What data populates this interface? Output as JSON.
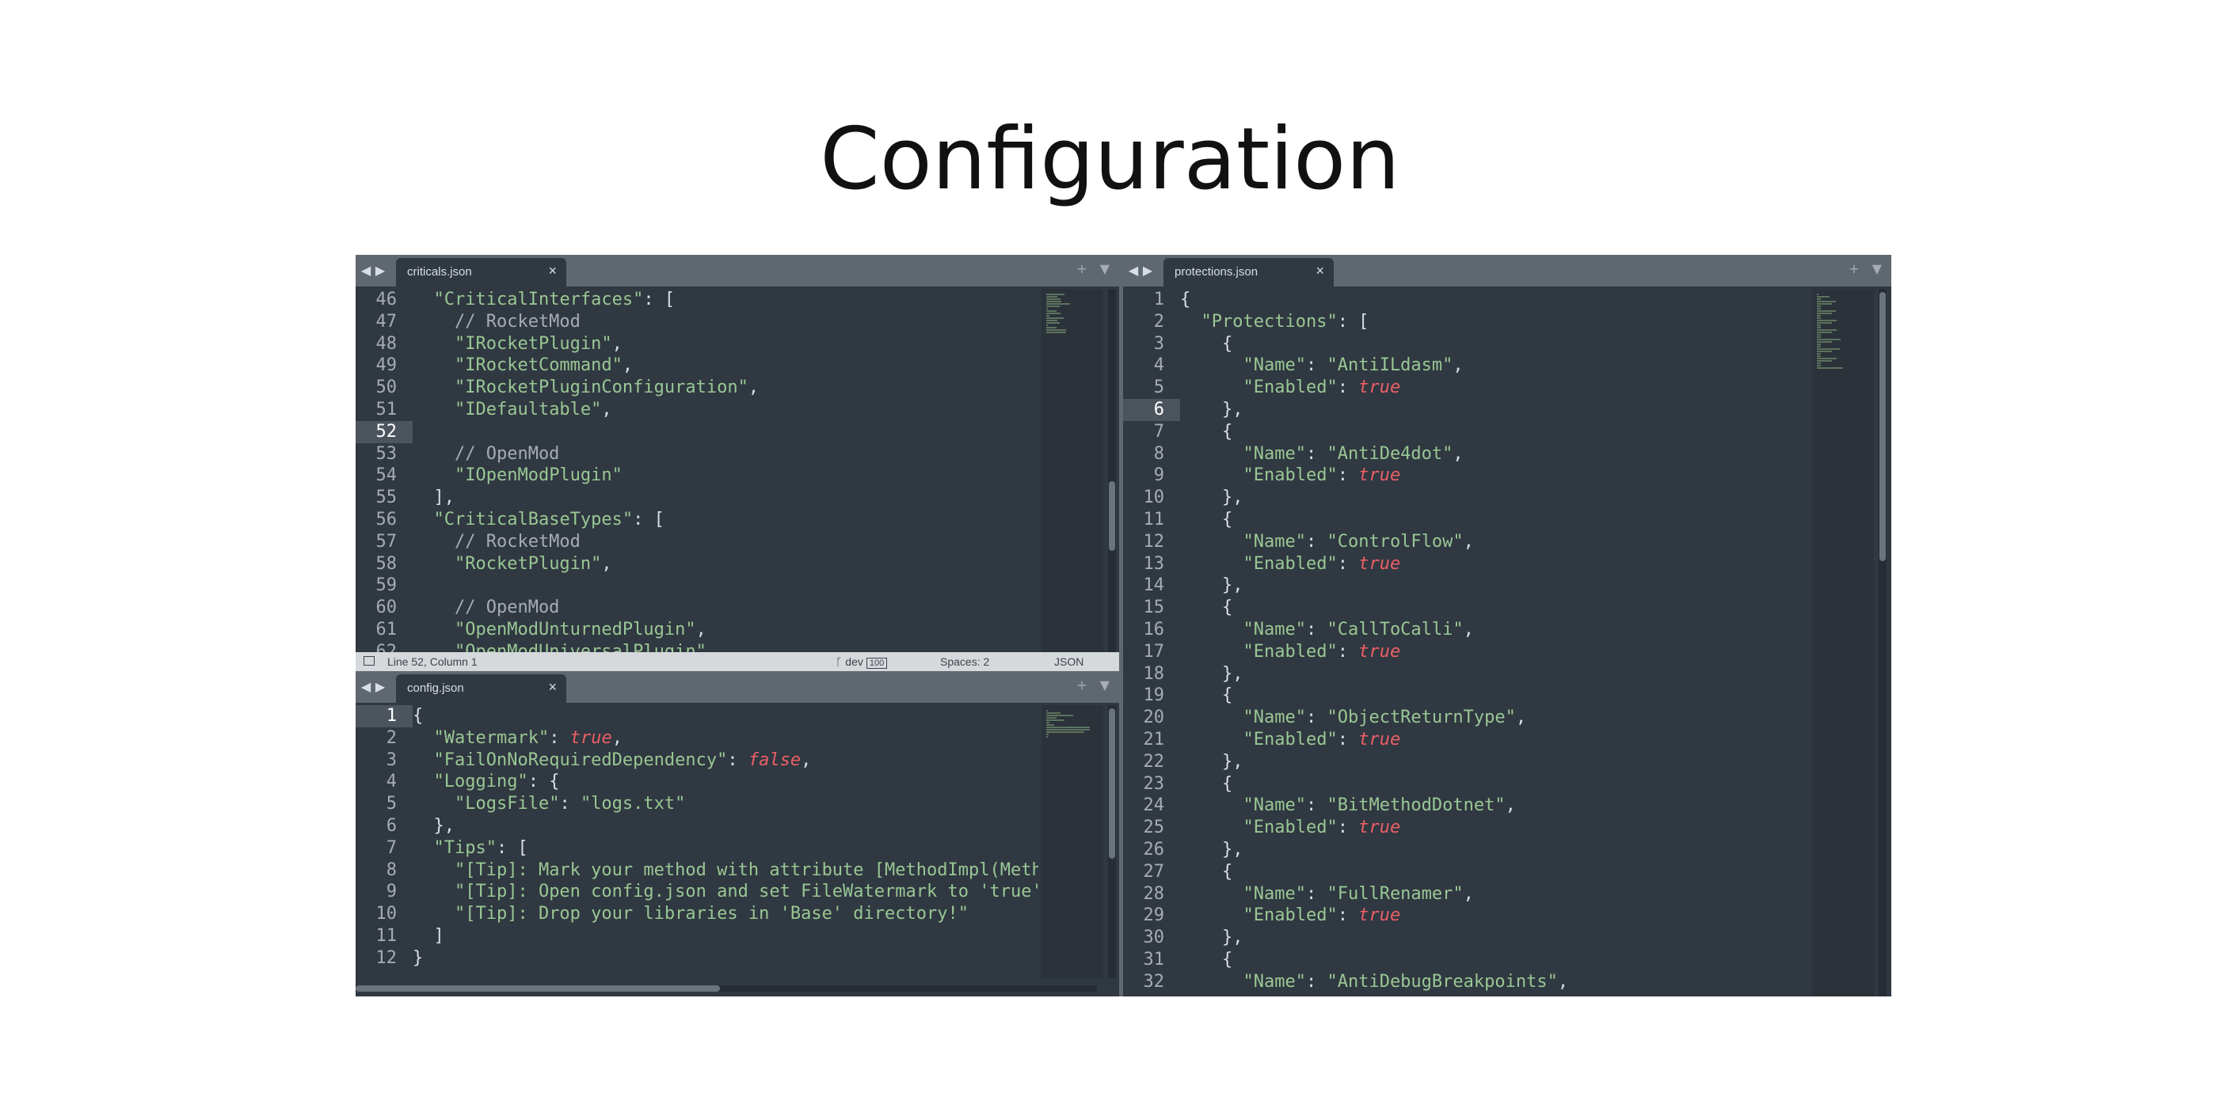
{
  "title": "Configuration",
  "nav": {
    "back": "◀",
    "forward": "▶"
  },
  "tab_actions": {
    "add": "+",
    "menu": "▼"
  },
  "colors": {
    "background": "#303841",
    "string": "#99c794",
    "keyword": "#ec5f66",
    "comment": "#a6acb3",
    "tabbar": "#5f6770"
  },
  "panes": {
    "criticals": {
      "tab": {
        "label": "criticals.json",
        "close": "×"
      },
      "active_line": 52,
      "lines": [
        {
          "n": "46",
          "tokens": [
            {
              "t": "  ",
              "k": "p"
            },
            {
              "t": "\"CriticalInterfaces\"",
              "k": "s"
            },
            {
              "t": ": [",
              "k": "p"
            }
          ]
        },
        {
          "n": "47",
          "tokens": [
            {
              "t": "    // RocketMod",
              "k": "c"
            }
          ]
        },
        {
          "n": "48",
          "tokens": [
            {
              "t": "    ",
              "k": "p"
            },
            {
              "t": "\"IRocketPlugin\"",
              "k": "s"
            },
            {
              "t": ",",
              "k": "p"
            }
          ]
        },
        {
          "n": "49",
          "tokens": [
            {
              "t": "    ",
              "k": "p"
            },
            {
              "t": "\"IRocketCommand\"",
              "k": "s"
            },
            {
              "t": ",",
              "k": "p"
            }
          ]
        },
        {
          "n": "50",
          "tokens": [
            {
              "t": "    ",
              "k": "p"
            },
            {
              "t": "\"IRocketPluginConfiguration\"",
              "k": "s"
            },
            {
              "t": ",",
              "k": "p"
            }
          ]
        },
        {
          "n": "51",
          "tokens": [
            {
              "t": "    ",
              "k": "p"
            },
            {
              "t": "\"IDefaultable\"",
              "k": "s"
            },
            {
              "t": ",",
              "k": "p"
            }
          ]
        },
        {
          "n": "52",
          "tokens": []
        },
        {
          "n": "53",
          "tokens": [
            {
              "t": "    // OpenMod",
              "k": "c"
            }
          ]
        },
        {
          "n": "54",
          "tokens": [
            {
              "t": "    ",
              "k": "p"
            },
            {
              "t": "\"IOpenModPlugin\"",
              "k": "s"
            }
          ]
        },
        {
          "n": "55",
          "tokens": [
            {
              "t": "  ],",
              "k": "p"
            }
          ]
        },
        {
          "n": "56",
          "tokens": [
            {
              "t": "  ",
              "k": "p"
            },
            {
              "t": "\"CriticalBaseTypes\"",
              "k": "s"
            },
            {
              "t": ": [",
              "k": "p"
            }
          ]
        },
        {
          "n": "57",
          "tokens": [
            {
              "t": "    // RocketMod",
              "k": "c"
            }
          ]
        },
        {
          "n": "58",
          "tokens": [
            {
              "t": "    ",
              "k": "p"
            },
            {
              "t": "\"RocketPlugin\"",
              "k": "s"
            },
            {
              "t": ",",
              "k": "p"
            }
          ]
        },
        {
          "n": "59",
          "tokens": []
        },
        {
          "n": "60",
          "tokens": [
            {
              "t": "    // OpenMod",
              "k": "c"
            }
          ]
        },
        {
          "n": "61",
          "tokens": [
            {
              "t": "    ",
              "k": "p"
            },
            {
              "t": "\"OpenModUnturnedPlugin\"",
              "k": "s"
            },
            {
              "t": ",",
              "k": "p"
            }
          ]
        },
        {
          "n": "62",
          "tokens": [
            {
              "t": "    ",
              "k": "p"
            },
            {
              "t": "\"OpenModUniversalPlugin\"",
              "k": "s"
            }
          ]
        }
      ],
      "status": {
        "position": "Line 52, Column 1",
        "branch": "dev",
        "branch_badge": "100",
        "spaces": "Spaces: 2",
        "syntax": "JSON"
      }
    },
    "config": {
      "tab": {
        "label": "config.json",
        "close": "×"
      },
      "active_line": 1,
      "lines": [
        {
          "n": "1",
          "tokens": [
            {
              "t": "{",
              "k": "p"
            }
          ]
        },
        {
          "n": "2",
          "tokens": [
            {
              "t": "  ",
              "k": "p"
            },
            {
              "t": "\"Watermark\"",
              "k": "s"
            },
            {
              "t": ": ",
              "k": "p"
            },
            {
              "t": "true",
              "k": "b"
            },
            {
              "t": ",",
              "k": "p"
            }
          ]
        },
        {
          "n": "3",
          "tokens": [
            {
              "t": "  ",
              "k": "p"
            },
            {
              "t": "\"FailOnNoRequiredDependency\"",
              "k": "s"
            },
            {
              "t": ": ",
              "k": "p"
            },
            {
              "t": "false",
              "k": "b"
            },
            {
              "t": ",",
              "k": "p"
            }
          ]
        },
        {
          "n": "4",
          "tokens": [
            {
              "t": "  ",
              "k": "p"
            },
            {
              "t": "\"Logging\"",
              "k": "s"
            },
            {
              "t": ": {",
              "k": "p"
            }
          ]
        },
        {
          "n": "5",
          "tokens": [
            {
              "t": "    ",
              "k": "p"
            },
            {
              "t": "\"LogsFile\"",
              "k": "s"
            },
            {
              "t": ": ",
              "k": "p"
            },
            {
              "t": "\"logs.txt\"",
              "k": "s"
            }
          ]
        },
        {
          "n": "6",
          "tokens": [
            {
              "t": "  },",
              "k": "p"
            }
          ]
        },
        {
          "n": "7",
          "tokens": [
            {
              "t": "  ",
              "k": "p"
            },
            {
              "t": "\"Tips\"",
              "k": "s"
            },
            {
              "t": ": [",
              "k": "p"
            }
          ]
        },
        {
          "n": "8",
          "tokens": [
            {
              "t": "    ",
              "k": "p"
            },
            {
              "t": "\"[Tip]: Mark your method with attribute [MethodImpl(Metho",
              "k": "s"
            }
          ]
        },
        {
          "n": "9",
          "tokens": [
            {
              "t": "    ",
              "k": "p"
            },
            {
              "t": "\"[Tip]: Open config.json and set FileWatermark to 'true'.",
              "k": "s"
            }
          ]
        },
        {
          "n": "10",
          "tokens": [
            {
              "t": "    ",
              "k": "p"
            },
            {
              "t": "\"[Tip]: Drop your libraries in 'Base' directory!\"",
              "k": "s"
            }
          ]
        },
        {
          "n": "11",
          "tokens": [
            {
              "t": "  ]",
              "k": "p"
            }
          ]
        },
        {
          "n": "12",
          "tokens": [
            {
              "t": "}",
              "k": "p"
            }
          ]
        }
      ]
    },
    "protections": {
      "tab": {
        "label": "protections.json",
        "close": "×"
      },
      "active_line": 6,
      "lines": [
        {
          "n": "1",
          "tokens": [
            {
              "t": "{",
              "k": "p"
            }
          ]
        },
        {
          "n": "2",
          "tokens": [
            {
              "t": "  ",
              "k": "p"
            },
            {
              "t": "\"Protections\"",
              "k": "s"
            },
            {
              "t": ": [",
              "k": "p"
            }
          ]
        },
        {
          "n": "3",
          "tokens": [
            {
              "t": "    {",
              "k": "p"
            }
          ]
        },
        {
          "n": "4",
          "tokens": [
            {
              "t": "      ",
              "k": "p"
            },
            {
              "t": "\"Name\"",
              "k": "s"
            },
            {
              "t": ": ",
              "k": "p"
            },
            {
              "t": "\"AntiILdasm\"",
              "k": "s"
            },
            {
              "t": ",",
              "k": "p"
            }
          ]
        },
        {
          "n": "5",
          "tokens": [
            {
              "t": "      ",
              "k": "p"
            },
            {
              "t": "\"Enabled\"",
              "k": "s"
            },
            {
              "t": ": ",
              "k": "p"
            },
            {
              "t": "true",
              "k": "b"
            }
          ]
        },
        {
          "n": "6",
          "tokens": [
            {
              "t": "    },",
              "k": "p"
            }
          ]
        },
        {
          "n": "7",
          "tokens": [
            {
              "t": "    {",
              "k": "p"
            }
          ]
        },
        {
          "n": "8",
          "tokens": [
            {
              "t": "      ",
              "k": "p"
            },
            {
              "t": "\"Name\"",
              "k": "s"
            },
            {
              "t": ": ",
              "k": "p"
            },
            {
              "t": "\"AntiDe4dot\"",
              "k": "s"
            },
            {
              "t": ",",
              "k": "p"
            }
          ]
        },
        {
          "n": "9",
          "tokens": [
            {
              "t": "      ",
              "k": "p"
            },
            {
              "t": "\"Enabled\"",
              "k": "s"
            },
            {
              "t": ": ",
              "k": "p"
            },
            {
              "t": "true",
              "k": "b"
            }
          ]
        },
        {
          "n": "10",
          "tokens": [
            {
              "t": "    },",
              "k": "p"
            }
          ]
        },
        {
          "n": "11",
          "tokens": [
            {
              "t": "    {",
              "k": "p"
            }
          ]
        },
        {
          "n": "12",
          "tokens": [
            {
              "t": "      ",
              "k": "p"
            },
            {
              "t": "\"Name\"",
              "k": "s"
            },
            {
              "t": ": ",
              "k": "p"
            },
            {
              "t": "\"ControlFlow\"",
              "k": "s"
            },
            {
              "t": ",",
              "k": "p"
            }
          ]
        },
        {
          "n": "13",
          "tokens": [
            {
              "t": "      ",
              "k": "p"
            },
            {
              "t": "\"Enabled\"",
              "k": "s"
            },
            {
              "t": ": ",
              "k": "p"
            },
            {
              "t": "true",
              "k": "b"
            }
          ]
        },
        {
          "n": "14",
          "tokens": [
            {
              "t": "    },",
              "k": "p"
            }
          ]
        },
        {
          "n": "15",
          "tokens": [
            {
              "t": "    {",
              "k": "p"
            }
          ]
        },
        {
          "n": "16",
          "tokens": [
            {
              "t": "      ",
              "k": "p"
            },
            {
              "t": "\"Name\"",
              "k": "s"
            },
            {
              "t": ": ",
              "k": "p"
            },
            {
              "t": "\"CallToCalli\"",
              "k": "s"
            },
            {
              "t": ",",
              "k": "p"
            }
          ]
        },
        {
          "n": "17",
          "tokens": [
            {
              "t": "      ",
              "k": "p"
            },
            {
              "t": "\"Enabled\"",
              "k": "s"
            },
            {
              "t": ": ",
              "k": "p"
            },
            {
              "t": "true",
              "k": "b"
            }
          ]
        },
        {
          "n": "18",
          "tokens": [
            {
              "t": "    },",
              "k": "p"
            }
          ]
        },
        {
          "n": "19",
          "tokens": [
            {
              "t": "    {",
              "k": "p"
            }
          ]
        },
        {
          "n": "20",
          "tokens": [
            {
              "t": "      ",
              "k": "p"
            },
            {
              "t": "\"Name\"",
              "k": "s"
            },
            {
              "t": ": ",
              "k": "p"
            },
            {
              "t": "\"ObjectReturnType\"",
              "k": "s"
            },
            {
              "t": ",",
              "k": "p"
            }
          ]
        },
        {
          "n": "21",
          "tokens": [
            {
              "t": "      ",
              "k": "p"
            },
            {
              "t": "\"Enabled\"",
              "k": "s"
            },
            {
              "t": ": ",
              "k": "p"
            },
            {
              "t": "true",
              "k": "b"
            }
          ]
        },
        {
          "n": "22",
          "tokens": [
            {
              "t": "    },",
              "k": "p"
            }
          ]
        },
        {
          "n": "23",
          "tokens": [
            {
              "t": "    {",
              "k": "p"
            }
          ]
        },
        {
          "n": "24",
          "tokens": [
            {
              "t": "      ",
              "k": "p"
            },
            {
              "t": "\"Name\"",
              "k": "s"
            },
            {
              "t": ": ",
              "k": "p"
            },
            {
              "t": "\"BitMethodDotnet\"",
              "k": "s"
            },
            {
              "t": ",",
              "k": "p"
            }
          ]
        },
        {
          "n": "25",
          "tokens": [
            {
              "t": "      ",
              "k": "p"
            },
            {
              "t": "\"Enabled\"",
              "k": "s"
            },
            {
              "t": ": ",
              "k": "p"
            },
            {
              "t": "true",
              "k": "b"
            }
          ]
        },
        {
          "n": "26",
          "tokens": [
            {
              "t": "    },",
              "k": "p"
            }
          ]
        },
        {
          "n": "27",
          "tokens": [
            {
              "t": "    {",
              "k": "p"
            }
          ]
        },
        {
          "n": "28",
          "tokens": [
            {
              "t": "      ",
              "k": "p"
            },
            {
              "t": "\"Name\"",
              "k": "s"
            },
            {
              "t": ": ",
              "k": "p"
            },
            {
              "t": "\"FullRenamer\"",
              "k": "s"
            },
            {
              "t": ",",
              "k": "p"
            }
          ]
        },
        {
          "n": "29",
          "tokens": [
            {
              "t": "      ",
              "k": "p"
            },
            {
              "t": "\"Enabled\"",
              "k": "s"
            },
            {
              "t": ": ",
              "k": "p"
            },
            {
              "t": "true",
              "k": "b"
            }
          ]
        },
        {
          "n": "30",
          "tokens": [
            {
              "t": "    },",
              "k": "p"
            }
          ]
        },
        {
          "n": "31",
          "tokens": [
            {
              "t": "    {",
              "k": "p"
            }
          ]
        },
        {
          "n": "32",
          "tokens": [
            {
              "t": "      ",
              "k": "p"
            },
            {
              "t": "\"Name\"",
              "k": "s"
            },
            {
              "t": ": ",
              "k": "p"
            },
            {
              "t": "\"AntiDebugBreakpoints\"",
              "k": "s"
            },
            {
              "t": ",",
              "k": "p"
            }
          ]
        }
      ]
    }
  }
}
